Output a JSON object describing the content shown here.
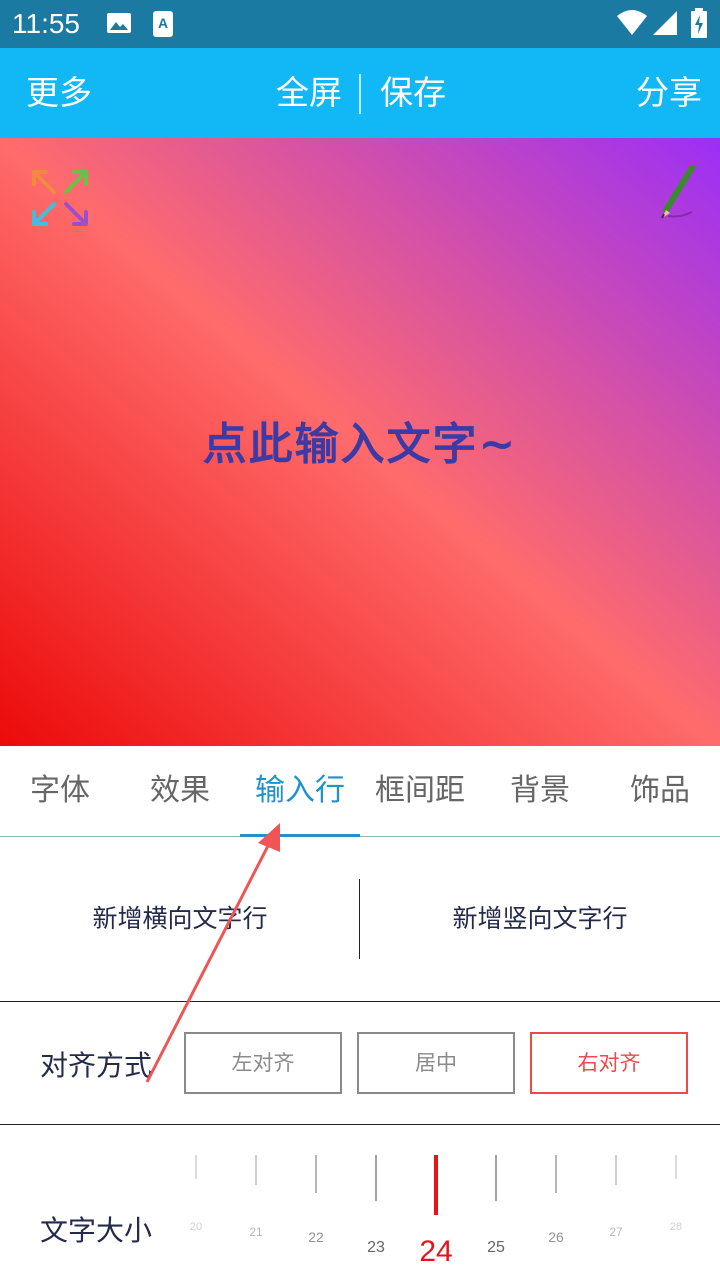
{
  "status_bar": {
    "time": "11:55",
    "icons": [
      "image-icon",
      "a-notification-icon",
      "wifi-icon",
      "signal-icon",
      "battery-charging-icon"
    ]
  },
  "toolbar": {
    "more": "更多",
    "fullscreen": "全屏",
    "save": "保存",
    "share": "分享"
  },
  "canvas": {
    "placeholder": "点此输入文字~",
    "gradient": [
      "#ec0a0a",
      "#ff6b6b",
      "#9b2ff7"
    ],
    "icons": [
      "expand-arrows-icon",
      "pencil-icon"
    ]
  },
  "tabs": [
    {
      "label": "字体",
      "active": false
    },
    {
      "label": "效果",
      "active": false
    },
    {
      "label": "输入行",
      "active": true
    },
    {
      "label": "框间距",
      "active": false
    },
    {
      "label": "背景",
      "active": false
    },
    {
      "label": "饰品",
      "active": false
    }
  ],
  "add_lines": {
    "horizontal": "新增横向文字行",
    "vertical": "新增竖向文字行"
  },
  "alignment": {
    "label": "对齐方式",
    "left": "左对齐",
    "center": "居中",
    "right": "右对齐",
    "selected": "右对齐"
  },
  "font_size": {
    "label": "文字大小",
    "ticks": [
      "20",
      "21",
      "22",
      "23",
      "24",
      "25",
      "26",
      "27",
      "28"
    ],
    "selected": "24"
  },
  "colors": {
    "toolbar": "#12b8f5",
    "status_bar": "#1a7aa1",
    "accent_blue": "#1e93c9",
    "accent_red": "#ef4a4a",
    "annotation_arrow": "#f05555"
  }
}
